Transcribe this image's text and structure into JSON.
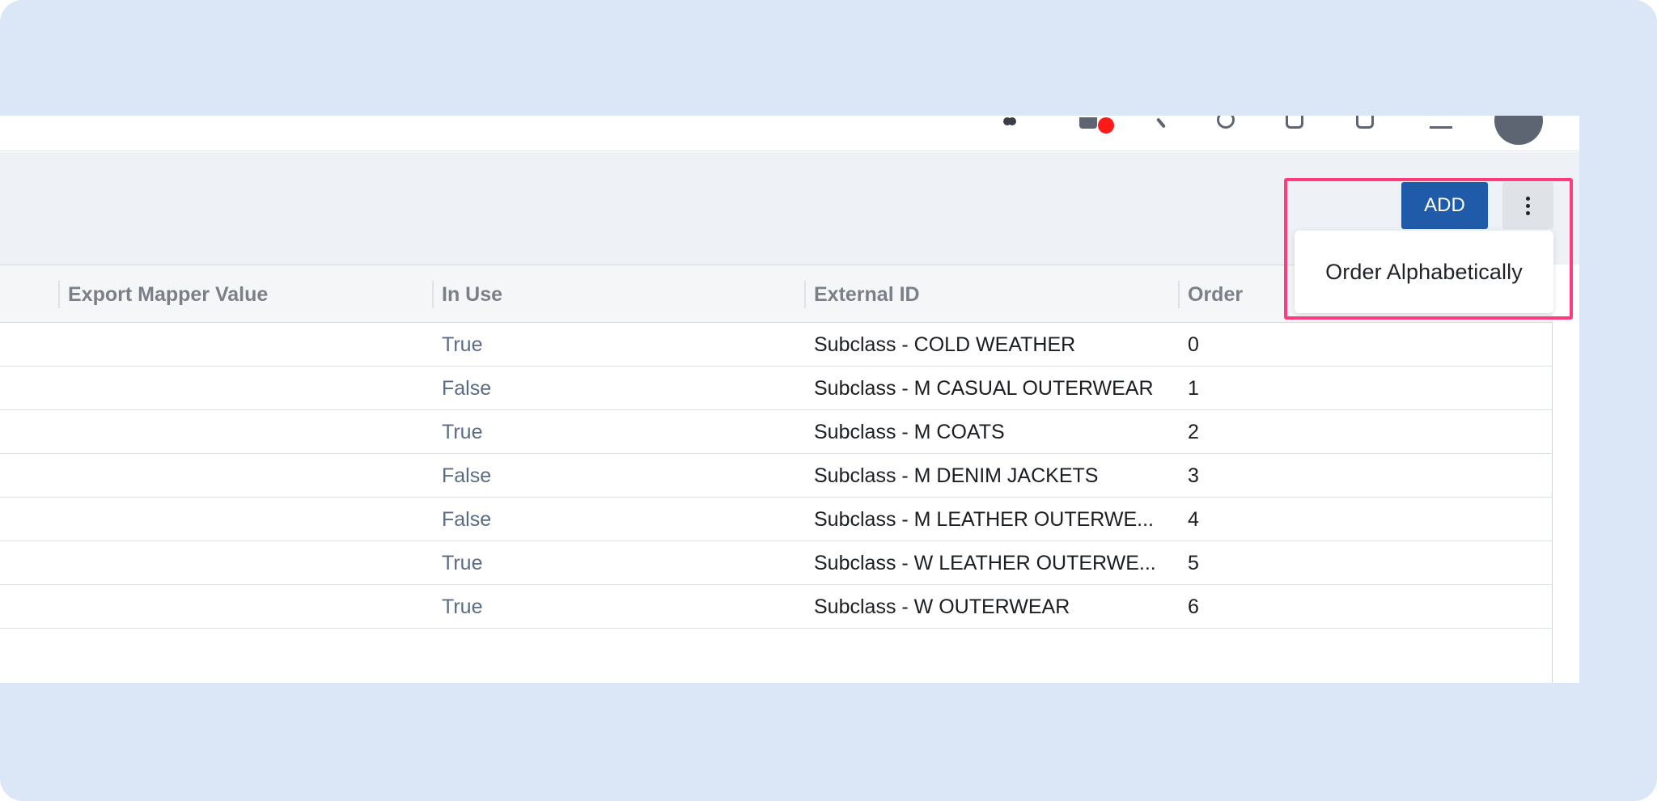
{
  "toolbar": {
    "add_label": "ADD",
    "more_menu": {
      "items": [
        {
          "label": "Order Alphabetically"
        }
      ]
    }
  },
  "table": {
    "columns": [
      "Export Mapper Value",
      "In Use",
      "External ID",
      "Order"
    ],
    "rows": [
      {
        "export_mapper_value": "",
        "in_use": "True",
        "external_id": "Subclass - COLD WEATHER",
        "order": "0"
      },
      {
        "export_mapper_value": "",
        "in_use": "False",
        "external_id": "Subclass - M CASUAL OUTERWEAR",
        "order": "1"
      },
      {
        "export_mapper_value": "",
        "in_use": "True",
        "external_id": "Subclass - M COATS",
        "order": "2"
      },
      {
        "export_mapper_value": "",
        "in_use": "False",
        "external_id": "Subclass - M DENIM JACKETS",
        "order": "3"
      },
      {
        "export_mapper_value": "",
        "in_use": "False",
        "external_id": "Subclass - M LEATHER OUTERWE...",
        "order": "4"
      },
      {
        "export_mapper_value": "",
        "in_use": "True",
        "external_id": "Subclass - W LEATHER OUTERWE...",
        "order": "5"
      },
      {
        "export_mapper_value": "",
        "in_use": "True",
        "external_id": "Subclass - W OUTERWEAR",
        "order": "6"
      }
    ]
  },
  "colors": {
    "frame_background": "#dbe7f7",
    "primary_button": "#1f5ba8",
    "highlight_border": "#ff3b7b",
    "notification_dot": "#ff1a1a",
    "in_use_text": "#5a6b85"
  },
  "icons": {
    "top_nav": [
      "people-icon",
      "notification-bell-icon",
      "search-icon",
      "help-icon",
      "user-card-icon",
      "clipboard-icon",
      "menu-icon",
      "avatar"
    ]
  }
}
